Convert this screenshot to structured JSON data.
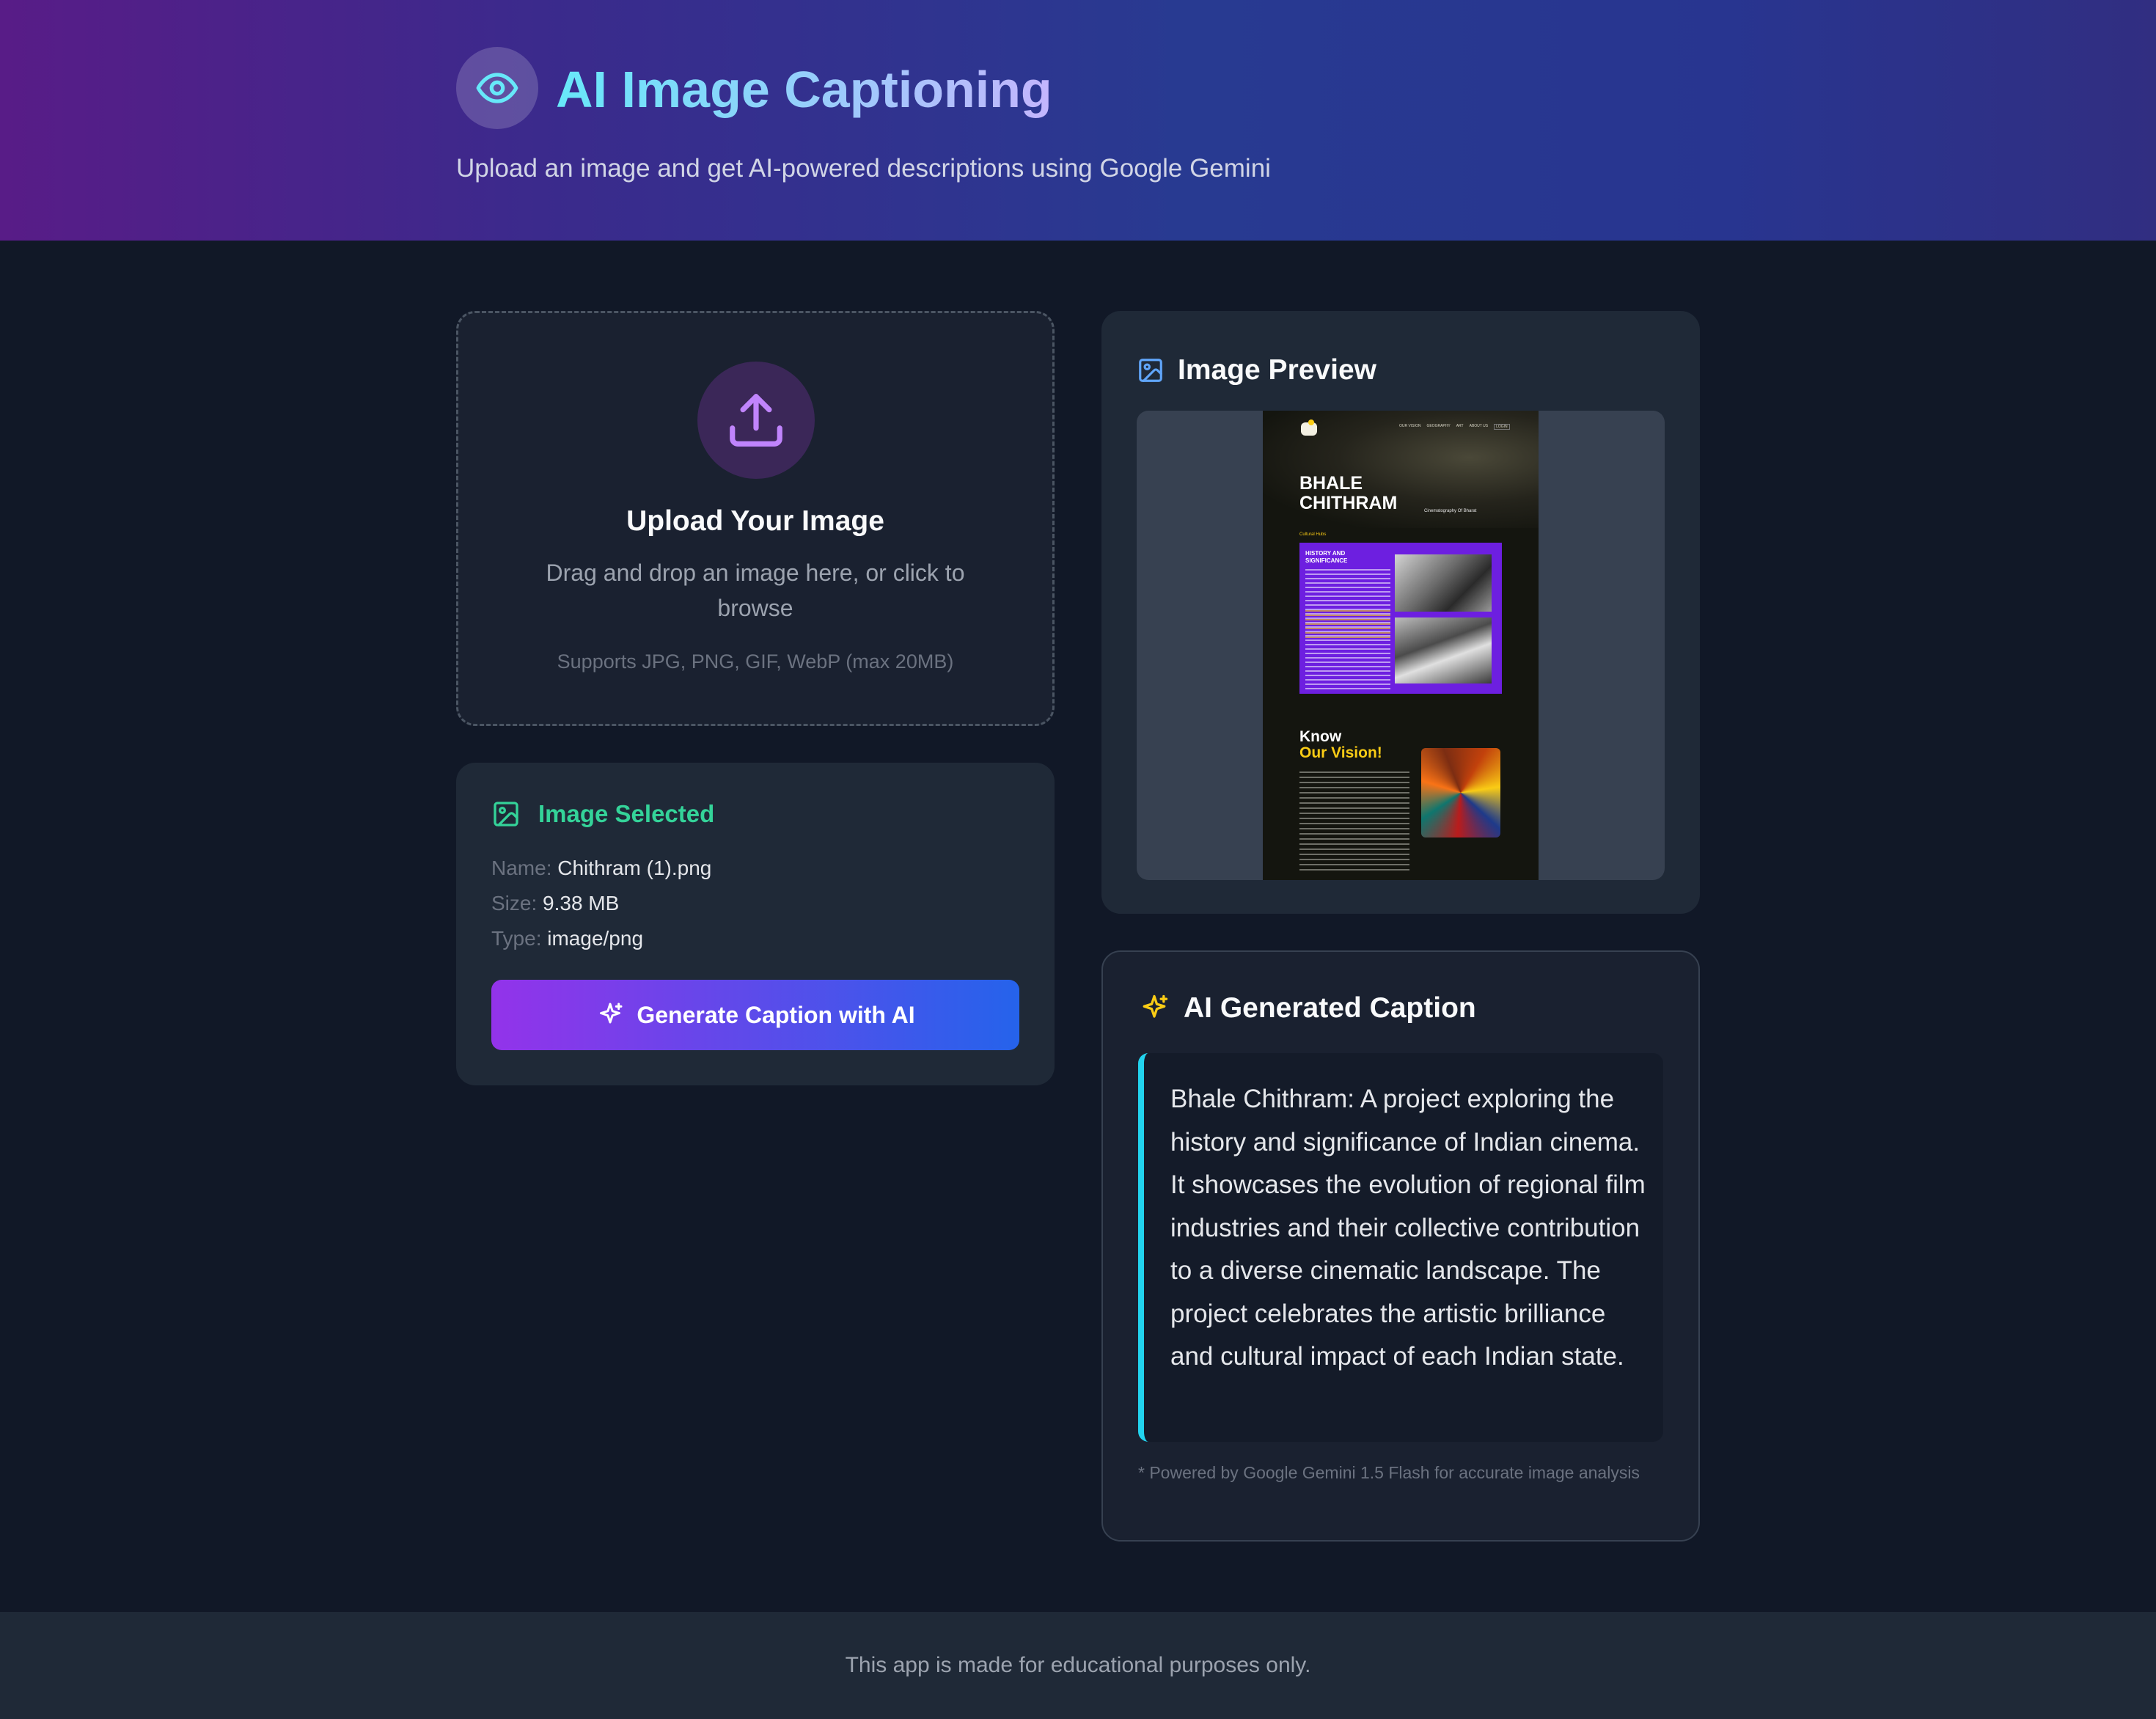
{
  "header": {
    "title": "AI Image Captioning",
    "subtitle": "Upload an image and get AI-powered descriptions using Google Gemini",
    "logo_icon": "eye-icon",
    "accent_from": "#67e8f9",
    "accent_to": "#c4b5fd"
  },
  "upload": {
    "icon": "upload-icon",
    "title": "Upload Your Image",
    "description": "Drag and drop an image here, or click to browse",
    "supports": "Supports JPG, PNG, GIF, WebP (max 20MB)"
  },
  "selected": {
    "icon": "image-icon",
    "title": "Image Selected",
    "name_label": "Name:",
    "name_value": "Chithram (1).png",
    "size_label": "Size:",
    "size_value": "9.38 MB",
    "type_label": "Type:",
    "type_value": "image/png",
    "generate_button": "Generate Caption with AI",
    "generate_icon": "sparkles-icon"
  },
  "preview": {
    "icon": "image-icon",
    "title": "Image Preview",
    "shot": {
      "nav": [
        "OUR VISION",
        "GEOGRAPHY",
        "ART",
        "ABOUT US",
        "LOGIN"
      ],
      "hero_line1": "BHALE",
      "hero_line2": "CHITHRAM",
      "hero_tag": "Cinematography Of Bharat",
      "section_tag": "Cultural Hubs",
      "history_title": "HISTORY AND SIGNIFICANCE",
      "vision_line1": "Know",
      "vision_line2": "Our Vision!"
    }
  },
  "caption": {
    "icon": "sparkles-icon",
    "title": "AI Generated Caption",
    "text": "Bhale Chithram: A project exploring the history and significance of Indian cinema. It showcases the evolution of regional film industries and their collective contribution to a diverse cinematic landscape. The project celebrates the artistic brilliance and cultural impact of each Indian state.",
    "powered": "* Powered by Google Gemini 1.5 Flash for accurate image analysis"
  },
  "footer": {
    "text": "This app is made for educational purposes only."
  }
}
